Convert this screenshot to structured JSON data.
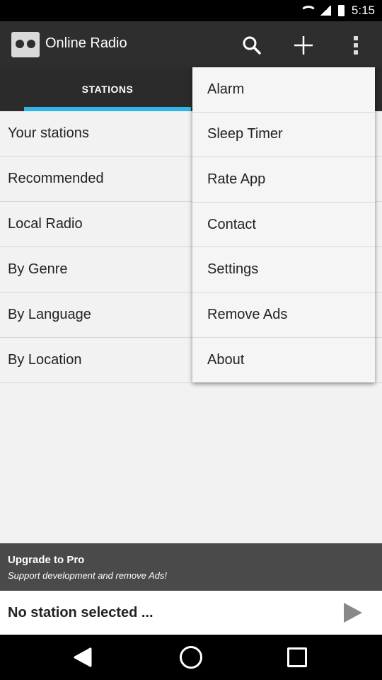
{
  "status_bar": {
    "time": "5:15"
  },
  "app_bar": {
    "title": "Online Radio",
    "logo_icon": "radio-logo-icon",
    "actions": [
      "search-icon",
      "add-icon",
      "overflow-menu-icon"
    ]
  },
  "tabs": {
    "active_label": "STATIONS",
    "accent_color": "#33b5e5"
  },
  "list": {
    "items": [
      {
        "label": "Your stations"
      },
      {
        "label": "Recommended"
      },
      {
        "label": "Local Radio"
      },
      {
        "label": "By Genre"
      },
      {
        "label": "By Language"
      },
      {
        "label": "By Location"
      }
    ]
  },
  "overflow_menu": {
    "items": [
      {
        "label": "Alarm"
      },
      {
        "label": "Sleep Timer"
      },
      {
        "label": "Rate App"
      },
      {
        "label": "Contact"
      },
      {
        "label": "Settings"
      },
      {
        "label": "Remove Ads"
      },
      {
        "label": "About"
      }
    ]
  },
  "promo": {
    "title": "Upgrade to Pro",
    "subtitle": "Support development and remove Ads!"
  },
  "player": {
    "status": "No station selected ...",
    "play_icon": "play-icon"
  },
  "nav_bar": {
    "icons": [
      "back-icon",
      "home-icon",
      "recent-apps-icon"
    ]
  }
}
